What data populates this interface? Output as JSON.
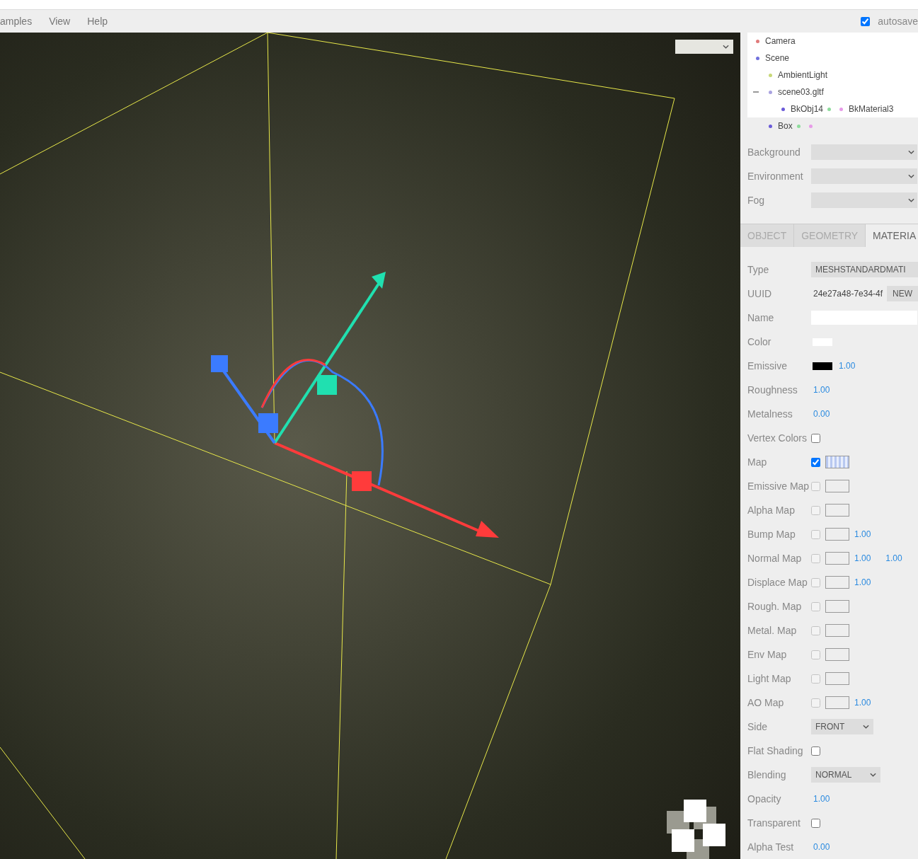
{
  "menubar": {
    "menus": [
      "amples",
      "View",
      "Help"
    ],
    "autosave": {
      "label": "autosave",
      "checked": true
    }
  },
  "outliner": [
    {
      "label": "Camera",
      "color": "#e07a7a",
      "selected": false
    },
    {
      "label": "Scene",
      "color": "#7070dd",
      "selected": false,
      "children": [
        {
          "label": "AmbientLight",
          "color": "#c8d878",
          "selected": false
        },
        {
          "label": "scene03.gltf",
          "color": "#a9a2e0",
          "selected": false,
          "expanded": true,
          "children": [
            {
              "label": "BkObj14",
              "color": "#6a5ad8",
              "selected": false,
              "extras": [
                {
                  "color": "#8edc9c"
                },
                {
                  "color": "#e79be8",
                  "label": "BkMaterial3"
                }
              ]
            }
          ]
        },
        {
          "label": "Box",
          "color": "#6a5ad8",
          "selected": true,
          "extras": [
            {
              "color": "#8edc9c"
            },
            {
              "color": "#e79be8"
            }
          ]
        }
      ]
    }
  ],
  "scene_settings": [
    {
      "label": "Background"
    },
    {
      "label": "Environment"
    },
    {
      "label": "Fog"
    }
  ],
  "tabs": [
    {
      "label": "OBJECT",
      "selected": false
    },
    {
      "label": "GEOMETRY",
      "selected": false
    },
    {
      "label": "MATERIA",
      "selected": true
    }
  ],
  "properties": [
    {
      "label": "Type",
      "kind": "select",
      "value": "MESHSTANDARDMATI"
    },
    {
      "label": "UUID",
      "kind": "uuid",
      "value": "24e27a48-7e34-4f",
      "button": "NEW"
    },
    {
      "label": "Name",
      "kind": "input"
    },
    {
      "label": "Color",
      "kind": "color",
      "color": "#ffffff"
    },
    {
      "label": "Emissive",
      "kind": "color",
      "color": "#000000",
      "value": "1.00"
    },
    {
      "label": "Roughness",
      "kind": "number",
      "value": "1.00"
    },
    {
      "label": "Metalness",
      "kind": "number",
      "value": "0.00"
    },
    {
      "label": "Vertex Colors",
      "kind": "checkbox",
      "checked": false
    },
    {
      "label": "Map",
      "kind": "map",
      "checked": true,
      "textured": true
    },
    {
      "label": "Emissive Map",
      "kind": "map",
      "checked": false,
      "textured": false
    },
    {
      "label": "Alpha Map",
      "kind": "map",
      "checked": false,
      "textured": false
    },
    {
      "label": "Bump Map",
      "kind": "map",
      "checked": false,
      "textured": false,
      "values": [
        "1.00"
      ]
    },
    {
      "label": "Normal Map",
      "kind": "map",
      "checked": false,
      "textured": false,
      "values": [
        "1.00",
        "1.00"
      ]
    },
    {
      "label": "Displace Map",
      "kind": "map",
      "checked": false,
      "textured": false,
      "values": [
        "1.00"
      ]
    },
    {
      "label": "Rough. Map",
      "kind": "map",
      "checked": false,
      "textured": false
    },
    {
      "label": "Metal. Map",
      "kind": "map",
      "checked": false,
      "textured": false
    },
    {
      "label": "Env Map",
      "kind": "map",
      "checked": false,
      "textured": false
    },
    {
      "label": "Light Map",
      "kind": "map",
      "checked": false,
      "textured": false
    },
    {
      "label": "AO Map",
      "kind": "map",
      "checked": false,
      "textured": false,
      "values": [
        "1.00"
      ]
    },
    {
      "label": "Side",
      "kind": "select",
      "value": "FRONT"
    },
    {
      "label": "Flat Shading",
      "kind": "checkbox",
      "checked": false
    },
    {
      "label": "Blending",
      "kind": "select",
      "value": "NORMAL"
    },
    {
      "label": "Opacity",
      "kind": "number",
      "value": "1.00"
    },
    {
      "label": "Transparent",
      "kind": "checkbox",
      "checked": false
    },
    {
      "label": "Alpha Test",
      "kind": "number",
      "value": "0.00"
    }
  ]
}
